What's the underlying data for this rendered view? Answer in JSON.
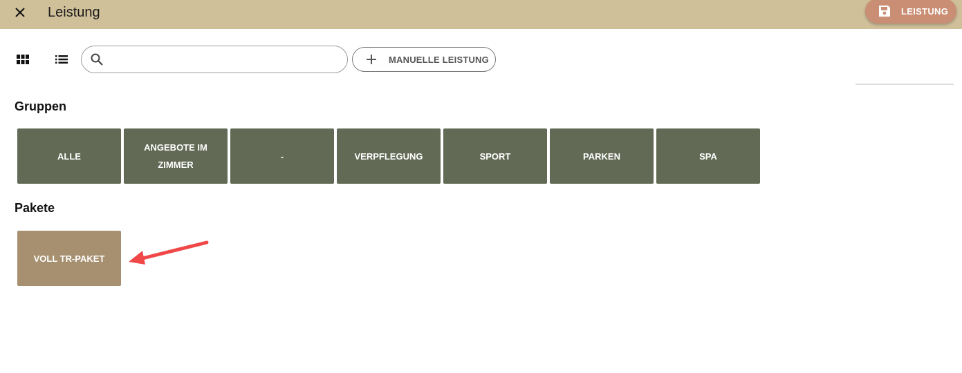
{
  "header": {
    "title": "Leistung",
    "save_label": "LEISTUNG"
  },
  "toolbar": {
    "search_placeholder": "",
    "search_value": "",
    "manual_label": "MANUELLE LEISTUNG"
  },
  "groups": {
    "heading": "Gruppen",
    "items": [
      {
        "label": "ALLE"
      },
      {
        "label": "ANGEBOTE IM ZIMMER"
      },
      {
        "label": "-"
      },
      {
        "label": "VERPFLEGUNG"
      },
      {
        "label": "SPORT"
      },
      {
        "label": "PARKEN"
      },
      {
        "label": "SPA"
      }
    ]
  },
  "packages": {
    "heading": "Pakete",
    "items": [
      {
        "label": "VOLL TR-PAKET"
      }
    ]
  },
  "colors": {
    "topbar": "#d0c09a",
    "save_button": "#c98e73",
    "group_tile": "#626a55",
    "package_tile": "#a69070",
    "annotation_arrow": "#f04848"
  },
  "icons": [
    "close-icon",
    "save-icon",
    "grid-view-icon",
    "list-view-icon",
    "search-icon",
    "plus-icon"
  ]
}
